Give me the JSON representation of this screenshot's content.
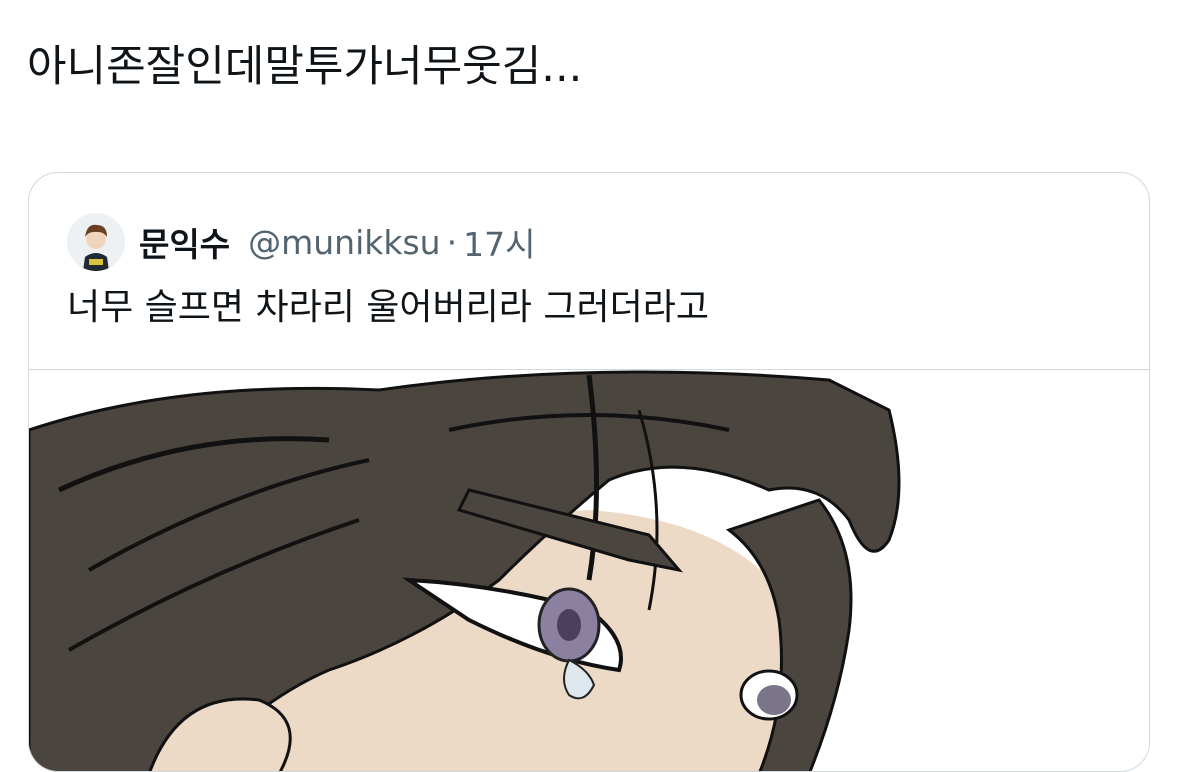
{
  "tweet": {
    "text": "아니존잘인데말투가너무웃김..."
  },
  "quoted_tweet": {
    "author_name": "문익수",
    "handle": "@munikksu",
    "separator": "·",
    "time": "17시",
    "text": "너무 슬프면 차라리 울어버리라 그러더라고",
    "avatar_icon": "avatar-illustration",
    "media": "illustration-crying-character"
  },
  "colors": {
    "text_primary": "#0f1419",
    "text_secondary": "#536471",
    "border": "#cfd9de",
    "hair": "#4b4540",
    "skin": "#ecdac6",
    "iris": "#8c80a0"
  }
}
